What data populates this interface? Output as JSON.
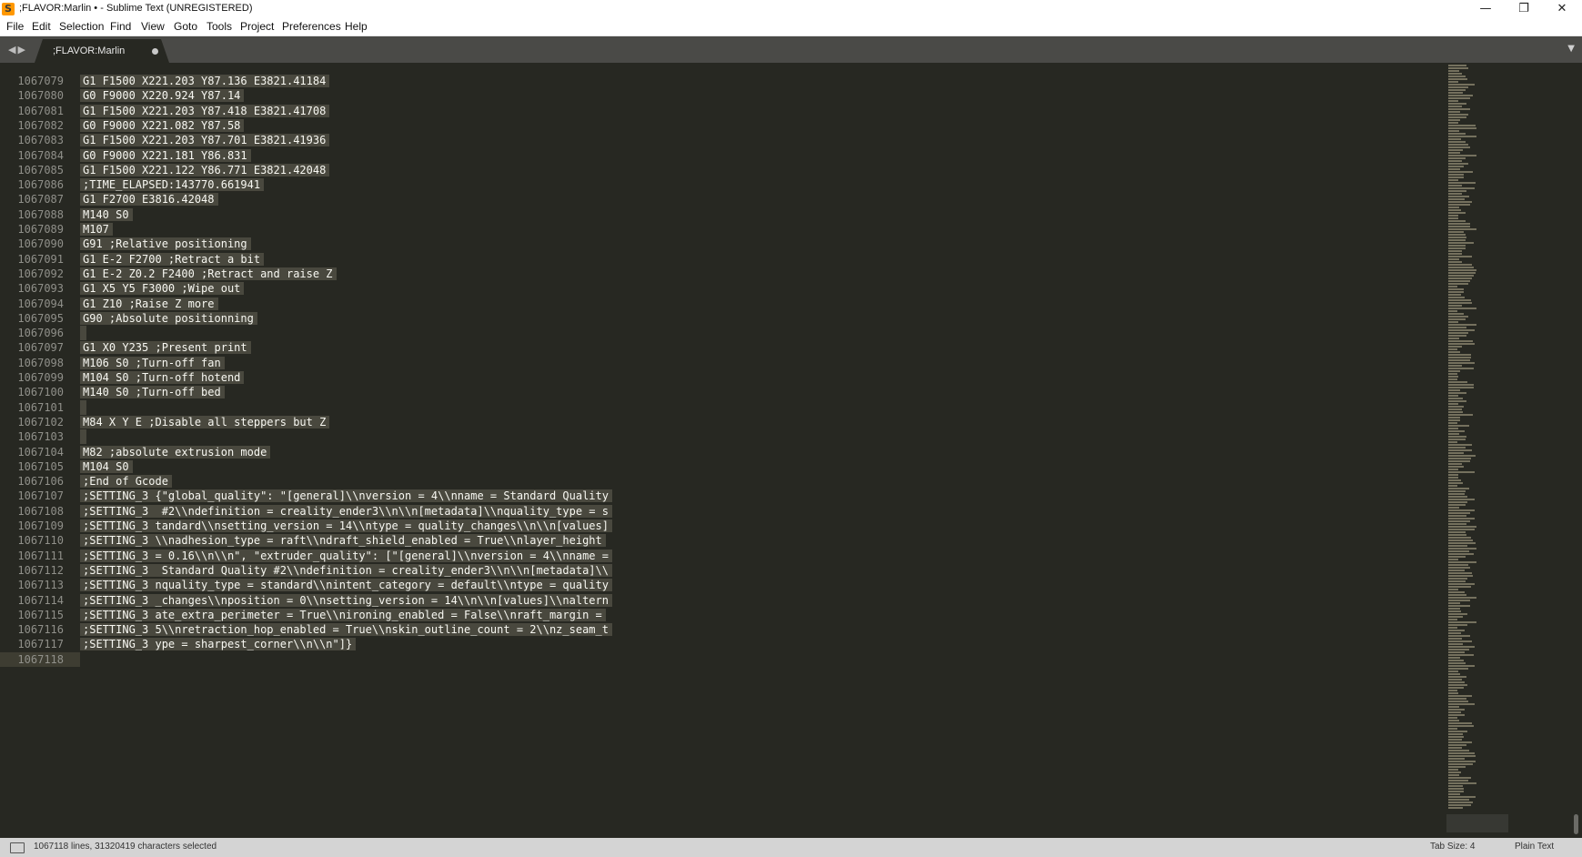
{
  "window": {
    "title": ";FLAVOR:Marlin • - Sublime Text (UNREGISTERED)",
    "app_icon": "sublime-text-logo",
    "controls": {
      "minimize": "—",
      "maximize": "❐",
      "close": "✕"
    }
  },
  "menu": [
    "File",
    "Edit",
    "Selection",
    "Find",
    "View",
    "Goto",
    "Tools",
    "Project",
    "Preferences",
    "Help"
  ],
  "tabs": [
    {
      "label": ";FLAVOR:Marlin",
      "dirty": true
    }
  ],
  "nav": {
    "back": "◀",
    "forward": "▶",
    "dropdown": "▼"
  },
  "editor": {
    "lines": [
      {
        "n": "1067079",
        "code": "G1 F1500 X221.203 Y87.136 E3821.41184"
      },
      {
        "n": "1067080",
        "code": "G0 F9000 X220.924 Y87.14"
      },
      {
        "n": "1067081",
        "code": "G1 F1500 X221.203 Y87.418 E3821.41708"
      },
      {
        "n": "1067082",
        "code": "G0 F9000 X221.082 Y87.58"
      },
      {
        "n": "1067083",
        "code": "G1 F1500 X221.203 Y87.701 E3821.41936"
      },
      {
        "n": "1067084",
        "code": "G0 F9000 X221.181 Y86.831"
      },
      {
        "n": "1067085",
        "code": "G1 F1500 X221.122 Y86.771 E3821.42048"
      },
      {
        "n": "1067086",
        "code": ";TIME_ELAPSED:143770.661941"
      },
      {
        "n": "1067087",
        "code": "G1 F2700 E3816.42048"
      },
      {
        "n": "1067088",
        "code": "M140 S0"
      },
      {
        "n": "1067089",
        "code": "M107"
      },
      {
        "n": "1067090",
        "code": "G91 ;Relative positioning"
      },
      {
        "n": "1067091",
        "code": "G1 E-2 F2700 ;Retract a bit"
      },
      {
        "n": "1067092",
        "code": "G1 E-2 Z0.2 F2400 ;Retract and raise Z"
      },
      {
        "n": "1067093",
        "code": "G1 X5 Y5 F3000 ;Wipe out"
      },
      {
        "n": "1067094",
        "code": "G1 Z10 ;Raise Z more"
      },
      {
        "n": "1067095",
        "code": "G90 ;Absolute positionning"
      },
      {
        "n": "1067096",
        "code": ""
      },
      {
        "n": "1067097",
        "code": "G1 X0 Y235 ;Present print"
      },
      {
        "n": "1067098",
        "code": "M106 S0 ;Turn-off fan"
      },
      {
        "n": "1067099",
        "code": "M104 S0 ;Turn-off hotend"
      },
      {
        "n": "1067100",
        "code": "M140 S0 ;Turn-off bed"
      },
      {
        "n": "1067101",
        "code": ""
      },
      {
        "n": "1067102",
        "code": "M84 X Y E ;Disable all steppers but Z"
      },
      {
        "n": "1067103",
        "code": ""
      },
      {
        "n": "1067104",
        "code": "M82 ;absolute extrusion mode"
      },
      {
        "n": "1067105",
        "code": "M104 S0"
      },
      {
        "n": "1067106",
        "code": ";End of Gcode"
      },
      {
        "n": "1067107",
        "code": ";SETTING_3 {\"global_quality\": \"[general]\\\\nversion = 4\\\\nname = Standard Quality"
      },
      {
        "n": "1067108",
        "code": ";SETTING_3  #2\\\\ndefinition = creality_ender3\\\\n\\\\n[metadata]\\\\nquality_type = s"
      },
      {
        "n": "1067109",
        "code": ";SETTING_3 tandard\\\\nsetting_version = 14\\\\ntype = quality_changes\\\\n\\\\n[values]"
      },
      {
        "n": "1067110",
        "code": ";SETTING_3 \\\\nadhesion_type = raft\\\\ndraft_shield_enabled = True\\\\nlayer_height"
      },
      {
        "n": "1067111",
        "code": ";SETTING_3 = 0.16\\\\n\\\\n\", \"extruder_quality\": [\"[general]\\\\nversion = 4\\\\nname ="
      },
      {
        "n": "1067112",
        "code": ";SETTING_3  Standard Quality #2\\\\ndefinition = creality_ender3\\\\n\\\\n[metadata]\\\\"
      },
      {
        "n": "1067113",
        "code": ";SETTING_3 nquality_type = standard\\\\nintent_category = default\\\\ntype = quality"
      },
      {
        "n": "1067114",
        "code": ";SETTING_3 _changes\\\\nposition = 0\\\\nsetting_version = 14\\\\n\\\\n[values]\\\\naltern"
      },
      {
        "n": "1067115",
        "code": ";SETTING_3 ate_extra_perimeter = True\\\\nironing_enabled = False\\\\nraft_margin ="
      },
      {
        "n": "1067116",
        "code": ";SETTING_3 5\\\\nretraction_hop_enabled = True\\\\nskin_outline_count = 2\\\\nz_seam_t"
      },
      {
        "n": "1067117",
        "code": ";SETTING_3 ype = sharpest_corner\\\\n\\\\n\"]}"
      },
      {
        "n": "1067118",
        "code": ""
      }
    ]
  },
  "status": {
    "selection": "1067118 lines, 31320419 characters selected",
    "tab_size": "Tab Size: 4",
    "syntax": "Plain Text"
  },
  "colors": {
    "editor_bg": "#272822",
    "selection_bg": "#49483e",
    "text": "#f8f8f2",
    "gutter_text": "#90908a",
    "tabbar_bg": "#4a4a47",
    "status_bg": "#d4d4d4"
  }
}
